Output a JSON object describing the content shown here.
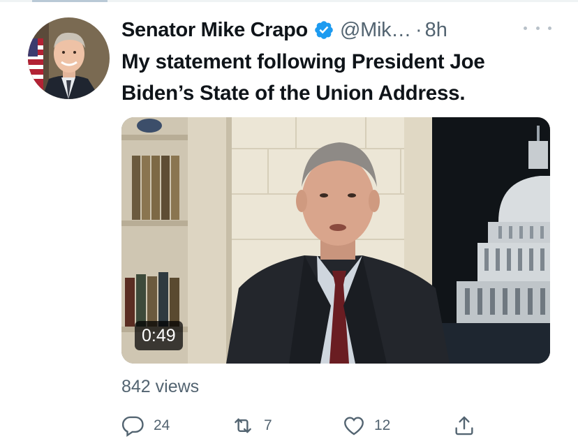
{
  "tweet": {
    "author_name": "Senator Mike Crapo",
    "handle": "@Mik…",
    "separator": "·",
    "time": "8h",
    "text_line1": "My statement following President Joe",
    "text_line2": "Biden’s State of the Union Address.",
    "video_duration": "0:49",
    "views": "842 views"
  },
  "actions": {
    "replies": "24",
    "retweets": "7",
    "likes": "12"
  },
  "icons": {
    "verified": "verified-badge-icon",
    "more": "more-dots-icon",
    "reply": "reply-icon",
    "retweet": "retweet-icon",
    "like": "heart-icon",
    "share": "share-icon"
  },
  "colors": {
    "text": "#0f1419",
    "secondary": "#536471",
    "verified": "#1d9bf0"
  }
}
